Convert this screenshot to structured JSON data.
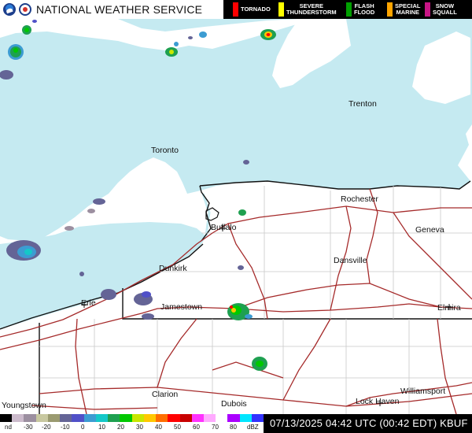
{
  "header": {
    "agency_title": "NATIONAL WEATHER SERVICE",
    "warnings": [
      {
        "label_line1": "TORNADO",
        "label_line2": "",
        "color": "#ff0000"
      },
      {
        "label_line1": "SEVERE",
        "label_line2": "THUNDERSTORM",
        "color": "#ffff00"
      },
      {
        "label_line1": "FLASH",
        "label_line2": "FLOOD",
        "color": "#00a000"
      },
      {
        "label_line1": "SPECIAL",
        "label_line2": "MARINE",
        "color": "#ffa500"
      },
      {
        "label_line1": "SNOW",
        "label_line2": "SQUALL",
        "color": "#c71585"
      }
    ]
  },
  "map": {
    "water_color": "#c5eaf1",
    "land_color": "#ffffff",
    "road_color": "#a52a2a",
    "cities": [
      {
        "name": "Trenton"
      },
      {
        "name": "Toronto"
      },
      {
        "name": "Rochester"
      },
      {
        "name": "Geneva"
      },
      {
        "name": "Buffalo"
      },
      {
        "name": "Dansville"
      },
      {
        "name": "Dunkirk"
      },
      {
        "name": "Erie"
      },
      {
        "name": "Jamestown"
      },
      {
        "name": "Elmira"
      },
      {
        "name": "Clarion"
      },
      {
        "name": "Williamsport"
      },
      {
        "name": "Dubois"
      },
      {
        "name": "Lock Haven"
      },
      {
        "name": "Youngstown"
      }
    ]
  },
  "footer": {
    "dbz_ticks": [
      "nd",
      "-30",
      "-20",
      "-10",
      "0",
      "10",
      "20",
      "30",
      "40",
      "50",
      "60",
      "70",
      "80",
      "dBZ"
    ],
    "dbz_colors": [
      "#000000",
      "#ccbbcc",
      "#9c8fa0",
      "#c8c8a0",
      "#9a9a70",
      "#646496",
      "#5050c8",
      "#3c9cd2",
      "#14c8c8",
      "#1ea050",
      "#00c800",
      "#c8e600",
      "#ffc800",
      "#ff6e00",
      "#ff0000",
      "#c80000",
      "#ff32ff",
      "#ffaaff",
      "#ffffff",
      "#aa00ff",
      "#00e6ff",
      "#3232ff"
    ],
    "timestamp": "07/13/2025 04:42 UTC (00:42 EDT)  KBUF"
  }
}
